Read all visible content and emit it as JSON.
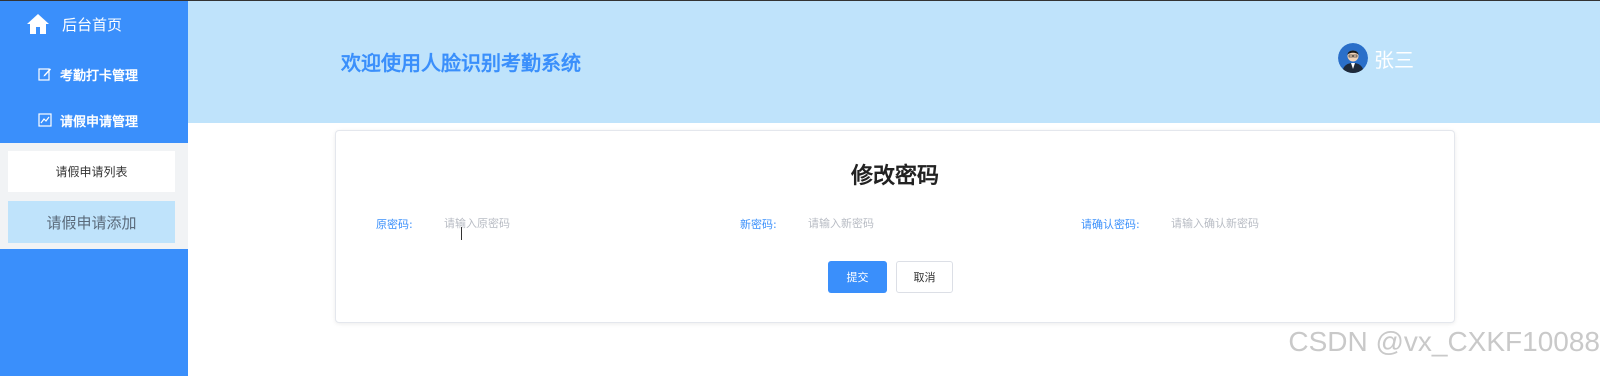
{
  "sidebar": {
    "home_label": "后台首页",
    "items": [
      {
        "label": "考勤打卡管理",
        "icon": "edit-icon"
      },
      {
        "label": "请假申请管理",
        "icon": "chart-icon"
      }
    ],
    "sub_items": [
      {
        "label": "请假申请列表"
      },
      {
        "label": "请假申请添加"
      }
    ]
  },
  "header": {
    "title": "欢迎使用人脸识别考勤系统",
    "username": "张三"
  },
  "form": {
    "title": "修改密码",
    "fields": [
      {
        "label": "原密码:",
        "placeholder": "请输入原密码"
      },
      {
        "label": "新密码:",
        "placeholder": "请输入新密码"
      },
      {
        "label": "请确认密码:",
        "placeholder": "请输入确认新密码"
      }
    ],
    "submit_label": "提交",
    "cancel_label": "取消"
  },
  "watermark": "CSDN @vx_CXKF10088",
  "colors": {
    "primary": "#3a8ffb",
    "header_bg": "#bfe3fb",
    "sidebar_sub_bg": "#f1f3f5"
  }
}
